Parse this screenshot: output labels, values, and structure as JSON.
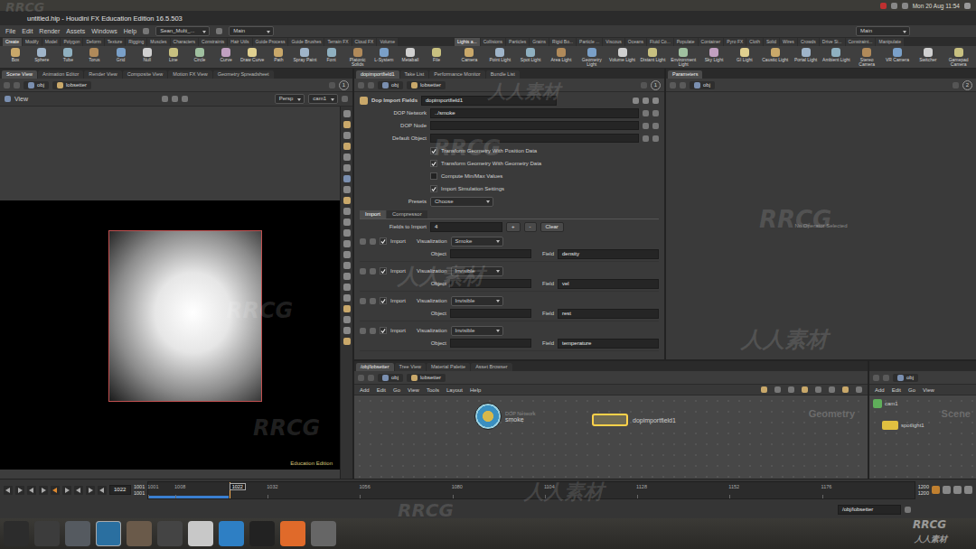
{
  "window": {
    "title": "untitled.hip - Houdini FX Education Edition 16.5.503"
  },
  "system_bar": {
    "clock": "Mon 20 Aug 11:54"
  },
  "menu": {
    "items": [
      "File",
      "Edit",
      "Render",
      "Assets",
      "Windows",
      "Help"
    ],
    "desktop": "Sean_Multi_...",
    "layout": "Main",
    "right_desktop": "Main"
  },
  "shelf_left": {
    "tabs": [
      {
        "label": "Create",
        "selected": true
      },
      {
        "label": "Modify",
        "selected": false
      },
      {
        "label": "Model",
        "selected": false
      },
      {
        "label": "Polygon",
        "selected": false
      },
      {
        "label": "Deform",
        "selected": false
      },
      {
        "label": "Texture",
        "selected": false
      },
      {
        "label": "Rigging",
        "selected": false
      },
      {
        "label": "Muscles",
        "selected": false
      },
      {
        "label": "Characters",
        "selected": false
      },
      {
        "label": "Constraints",
        "selected": false
      },
      {
        "label": "Hair Utils",
        "selected": false
      },
      {
        "label": "Guide Process",
        "selected": false
      },
      {
        "label": "Guide Brushes",
        "selected": false
      },
      {
        "label": "Terrain FX",
        "selected": false
      },
      {
        "label": "Cloud FX",
        "selected": false
      },
      {
        "label": "Volume",
        "selected": false
      }
    ],
    "tools": [
      "Box",
      "Sphere",
      "Tube",
      "Torus",
      "Grid",
      "Null",
      "Line",
      "Circle",
      "Curve",
      "Draw Curve",
      "Path",
      "Spray Paint",
      "Font",
      "Platonic Solids",
      "L-System",
      "Metaball",
      "File"
    ]
  },
  "shelf_right": {
    "tabs": [
      {
        "label": "Lights a...",
        "selected": true
      },
      {
        "label": "Collisions",
        "selected": false
      },
      {
        "label": "Particles",
        "selected": false
      },
      {
        "label": "Grains",
        "selected": false
      },
      {
        "label": "Rigid Bo...",
        "selected": false
      },
      {
        "label": "Particle ...",
        "selected": false
      },
      {
        "label": "Viscous",
        "selected": false
      },
      {
        "label": "Oceans",
        "selected": false
      },
      {
        "label": "Fluid Co...",
        "selected": false
      },
      {
        "label": "Populate",
        "selected": false
      },
      {
        "label": "Container",
        "selected": false
      },
      {
        "label": "Pyro FX",
        "selected": false
      },
      {
        "label": "Cloth",
        "selected": false
      },
      {
        "label": "Solid",
        "selected": false
      },
      {
        "label": "Wires",
        "selected": false
      },
      {
        "label": "Crowds",
        "selected": false
      },
      {
        "label": "Drive Si...",
        "selected": false
      },
      {
        "label": "Constraint...",
        "selected": false
      },
      {
        "label": "Manipulate",
        "selected": false
      }
    ],
    "tools": [
      "Camera",
      "Point Light",
      "Spot Light",
      "Area Light",
      "Geometry Light",
      "Volume Light",
      "Distant Light",
      "Environment Light",
      "Sky Light",
      "GI Light",
      "Caustic Light",
      "Portal Light",
      "Ambient Light",
      "Stereo Camera",
      "VR Camera",
      "Switcher",
      "Gamepad Camera"
    ]
  },
  "viewport": {
    "tabs": [
      {
        "label": "Scene View",
        "selected": true
      },
      {
        "label": "Animation Editor",
        "selected": false
      },
      {
        "label": "Render View",
        "selected": false
      },
      {
        "label": "Composite View",
        "selected": false
      },
      {
        "label": "Motion FX View",
        "selected": false
      },
      {
        "label": "Geometry Spreadsheet",
        "selected": false
      }
    ],
    "path": [
      "obj",
      "lobsetter"
    ],
    "pane_number": "1",
    "title": "View",
    "projection": "Persp",
    "camera": "cam1",
    "badge": "Education Edition"
  },
  "parameters": {
    "tabs": [
      {
        "label": "dopimportfield1",
        "selected": true
      },
      {
        "label": "Take List",
        "selected": false
      },
      {
        "label": "Performance Monitor",
        "selected": false
      },
      {
        "label": "Bundle List",
        "selected": false
      }
    ],
    "path": [
      "obj",
      "lobsetter"
    ],
    "pane_number": "1",
    "node_type": "Dop Import Fields",
    "node_name": "dopimportfield1",
    "fields": [
      {
        "label": "DOP Network",
        "value": "../smoke"
      },
      {
        "label": "DOP Node",
        "value": ""
      },
      {
        "label": "Default Object",
        "value": ""
      }
    ],
    "options": [
      {
        "label": "Transform Geometry With Position Data",
        "checked": true
      },
      {
        "label": "Transform Geometry With Geometry Data",
        "checked": true
      },
      {
        "label": "Compute Min/Max Values",
        "checked": false
      },
      {
        "label": "Import Simulation Settings",
        "checked": true
      }
    ],
    "presets": {
      "label": "Presets",
      "value": "Choose"
    },
    "folder_tabs": [
      {
        "label": "Import",
        "selected": true
      },
      {
        "label": "Compressor",
        "selected": false
      }
    ],
    "fields_count": {
      "label": "Fields to Import",
      "value": "4",
      "plus": "+",
      "minus": "-",
      "clear": "Clear"
    },
    "entries": [
      {
        "import_label": "Import",
        "checked": true,
        "vis_label": "Visualization",
        "visualization": "Smoke",
        "object_label": "Object",
        "object": "",
        "field_label": "Field",
        "field": "density"
      },
      {
        "import_label": "Import",
        "checked": true,
        "vis_label": "Visualization",
        "visualization": "Invisible",
        "object_label": "Object",
        "object": "",
        "field_label": "Field",
        "field": "vel"
      },
      {
        "import_label": "Import",
        "checked": true,
        "vis_label": "Visualization",
        "visualization": "Invisible",
        "object_label": "Object",
        "object": "",
        "field_label": "Field",
        "field": "rest"
      },
      {
        "import_label": "Import",
        "checked": true,
        "vis_label": "Visualization",
        "visualization": "Invisible",
        "object_label": "Object",
        "object": "",
        "field_label": "Field",
        "field": "temperature"
      }
    ]
  },
  "right_pane": {
    "tabs": [
      {
        "label": "Parameters",
        "selected": true
      }
    ],
    "path": [
      "obj"
    ],
    "pane_number": "2",
    "message": "No Operator Selected"
  },
  "network": {
    "tabs": [
      {
        "label": "/obj/lobsetter",
        "selected": true
      },
      {
        "label": "Tree View",
        "selected": false
      },
      {
        "label": "Material Palette",
        "selected": false
      },
      {
        "label": "Asset Browser",
        "selected": false
      }
    ],
    "path": [
      "obj",
      "lobsetter"
    ],
    "menu": [
      "Add",
      "Edit",
      "Go",
      "View",
      "Tools",
      "Layout",
      "Help"
    ],
    "context": "Geometry",
    "nodes": [
      {
        "kind": "dop",
        "type": "DOP Network",
        "name": "smoke",
        "selected": false
      },
      {
        "kind": "sop",
        "name": "dopimportfield1",
        "selected": true
      }
    ]
  },
  "scene_pane": {
    "path": [
      "obj"
    ],
    "menu": [
      "Add",
      "Edit",
      "Go",
      "View"
    ],
    "context": "Scene",
    "nodes": [
      {
        "kind": "camera",
        "name": "cam1"
      },
      {
        "kind": "light",
        "name": "spotlight1"
      }
    ]
  },
  "timeline": {
    "current": "1022",
    "range_start": "1001",
    "start": "1001",
    "end": "1200",
    "range_end": "1200",
    "ticks": [
      "1001",
      "1008",
      "1032",
      "1056",
      "1080",
      "1104",
      "1128",
      "1152",
      "1176"
    ],
    "cached_level": 0.105
  },
  "status": {
    "path": "/obj/lobsetter"
  },
  "watermarks": [
    {
      "text": "RRCG"
    },
    {
      "text": "人人素材"
    },
    {
      "text": "RRCG"
    },
    {
      "text": "RRCG"
    },
    {
      "text": "人人素材"
    },
    {
      "text": "RRCG"
    },
    {
      "text": "人人素材"
    },
    {
      "text": "RRCG"
    },
    {
      "text": "人人素材"
    },
    {
      "text": "RRCG"
    },
    {
      "text": "RRCG"
    },
    {
      "text": "人人素材"
    }
  ]
}
